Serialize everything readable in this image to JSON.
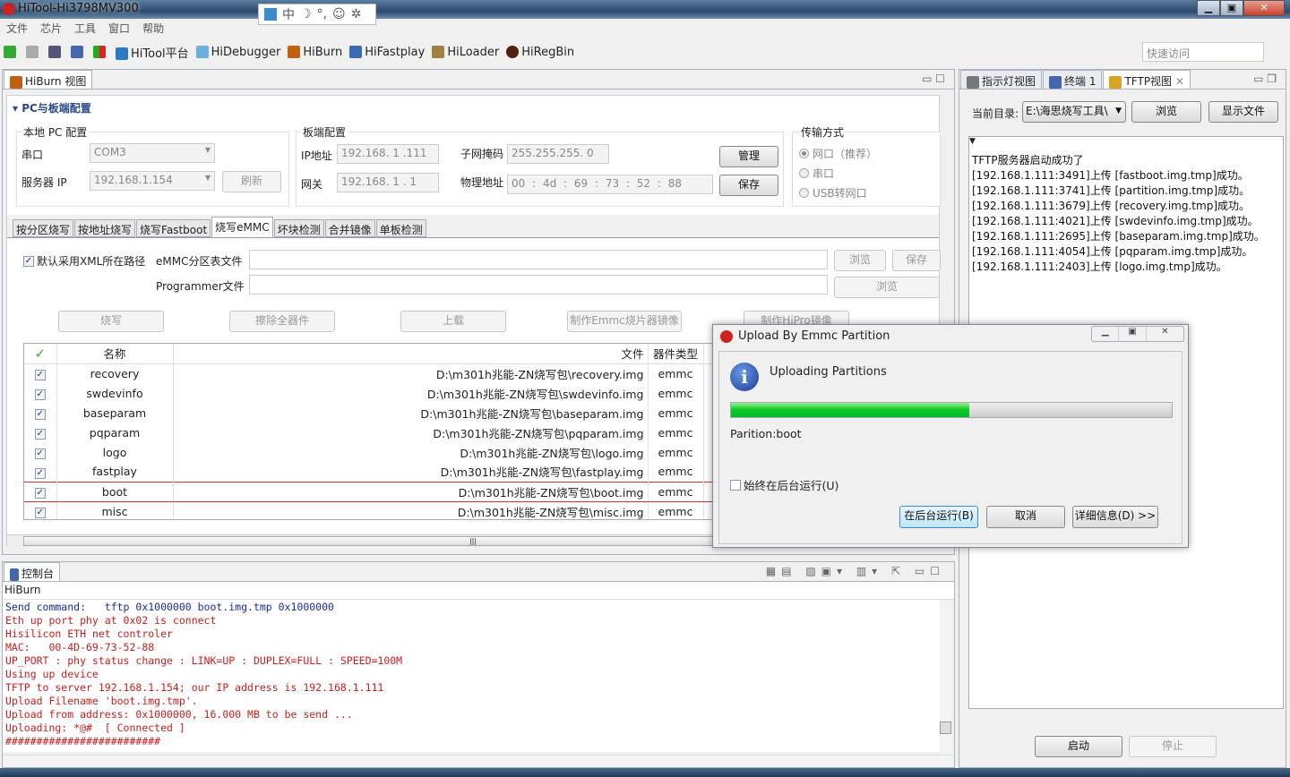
{
  "window": {
    "title": "HiTool-Hi3798MV300",
    "min": "▁",
    "max": "▣",
    "close": "✕"
  },
  "ime": [
    "中",
    "☽",
    "°,",
    "☺",
    "✲"
  ],
  "menu": [
    "文件",
    "芯片",
    "工具",
    "窗口",
    "帮助"
  ],
  "toolbar": {
    "items": [
      {
        "label": "HiTool平台",
        "color": "#2a7bc4"
      },
      {
        "label": "HiDebugger",
        "color": "#6ab0e0"
      },
      {
        "label": "HiBurn",
        "color": "#c06010"
      },
      {
        "label": "HiFastplay",
        "color": "#3a6ab0"
      },
      {
        "label": "HiLoader",
        "color": "#a08040"
      },
      {
        "label": "HiRegBin",
        "color": "#502010"
      }
    ],
    "quick_access_placeholder": "快速访问"
  },
  "hiburn": {
    "view_tab": "HiBurn 视图",
    "section": "PC与板端配置",
    "local": {
      "title": "本地 PC 配置",
      "serial_label": "串口",
      "serial_value": "COM3",
      "server_ip_label": "服务器 IP",
      "server_ip_value": "192.168.1.154",
      "refresh": "刷新"
    },
    "board": {
      "title": "板端配置",
      "ip_label": "IP地址",
      "ip": [
        "192",
        "168",
        "1",
        "111"
      ],
      "gw_label": "网关",
      "gw": [
        "192",
        "168",
        "1",
        "1"
      ],
      "mask_label": "子网掩码",
      "mask": [
        "255",
        "255",
        "255",
        "0"
      ],
      "mac_label": "物理地址",
      "mac": [
        "00",
        "4d",
        "69",
        "73",
        "52",
        "88"
      ],
      "manage": "管理",
      "save": "保存"
    },
    "transfer": {
      "title": "传输方式",
      "options": [
        "网口（推荐）",
        "串口",
        "USB转网口"
      ],
      "selected": 0
    },
    "tabs": [
      "按分区烧写",
      "按地址烧写",
      "烧写Fastboot",
      "烧写eMMC",
      "坏块检测",
      "合并镜像",
      "单板检测"
    ],
    "active_tab": 3,
    "emmc": {
      "default_xml": "默认采用XML所在路径",
      "default_xml_checked": true,
      "partition_label": "eMMC分区表文件",
      "partition_value": "",
      "programmer_label": "Programmer文件",
      "programmer_value": "",
      "browse": "浏览",
      "save": "保存"
    },
    "actions": [
      "烧写",
      "擦除全器件",
      "上载",
      "制作Emmc烧片器镜像",
      "制作HiPro镜像"
    ],
    "table": {
      "headers": [
        "名称",
        "文件",
        "器件类型"
      ],
      "rows": [
        {
          "name": "recovery",
          "file": "D:\\m301h兆能-ZN烧写包\\recovery.img",
          "type": "emmc"
        },
        {
          "name": "swdevinfo",
          "file": "D:\\m301h兆能-ZN烧写包\\swdevinfo.img",
          "type": "emmc"
        },
        {
          "name": "baseparam",
          "file": "D:\\m301h兆能-ZN烧写包\\baseparam.img",
          "type": "emmc"
        },
        {
          "name": "pqparam",
          "file": "D:\\m301h兆能-ZN烧写包\\pqparam.img",
          "type": "emmc"
        },
        {
          "name": "logo",
          "file": "D:\\m301h兆能-ZN烧写包\\logo.img",
          "type": "emmc"
        },
        {
          "name": "fastplay",
          "file": "D:\\m301h兆能-ZN烧写包\\fastplay.img",
          "type": "emmc"
        },
        {
          "name": "boot",
          "file": "D:\\m301h兆能-ZN烧写包\\boot.img",
          "type": "emmc",
          "selected": true
        },
        {
          "name": "misc",
          "file": "D:\\m301h兆能-ZN烧写包\\misc.img",
          "type": "emmc"
        }
      ]
    }
  },
  "dialog": {
    "title": "Upload By Emmc Partition",
    "message": "Uploading Partitions",
    "progress_percent": 54,
    "status": "Parition:boot",
    "always_bg": "始终在后台运行(U)",
    "run_bg": "在后台运行(B)",
    "cancel": "取消",
    "details": "详细信息(D) >>"
  },
  "console": {
    "tab": "控制台",
    "source": "HiBurn",
    "lines": [
      {
        "text": "Send command:   tftp 0x1000000 boot.img.tmp 0x1000000",
        "color": "#1a2aa0"
      },
      {
        "text": "Eth up port phy at 0x02 is connect"
      },
      {
        "text": "Hisilicon ETH net controler"
      },
      {
        "text": "MAC:   00-4D-69-73-52-88"
      },
      {
        "text": "UP_PORT : phy status change : LINK=UP : DUPLEX=FULL : SPEED=100M"
      },
      {
        "text": "Using up device"
      },
      {
        "text": "TFTP to server 192.168.1.154; our IP address is 192.168.1.111"
      },
      {
        "text": "Upload Filename 'boot.img.tmp'."
      },
      {
        "text": "Upload from address: 0x1000000, 16.000 MB to be send ..."
      },
      {
        "text": "Uploading: *@#  [ Connected ]"
      },
      {
        "text": "#########################"
      }
    ]
  },
  "right": {
    "tabs": [
      "指示灯视图",
      "终端 1",
      "TFTP视图"
    ],
    "dir_label": "当前目录:",
    "dir_value": "E:\\海思烧写工具\\",
    "browse": "浏览",
    "show_files": "显示文件",
    "log": [
      "TFTP服务器启动成功了",
      "[192.168.1.111:3491]上传 [fastboot.img.tmp]成功。",
      "[192.168.1.111:3741]上传 [partition.img.tmp]成功。",
      "[192.168.1.111:3679]上传 [recovery.img.tmp]成功。",
      "[192.168.1.111:4021]上传 [swdevinfo.img.tmp]成功。",
      "[192.168.1.111:2695]上传 [baseparam.img.tmp]成功。",
      "[192.168.1.111:4054]上传 [pqparam.img.tmp]成功。",
      "[192.168.1.111:2403]上传 [logo.img.tmp]成功。"
    ],
    "start": "启动",
    "stop": "停止"
  }
}
